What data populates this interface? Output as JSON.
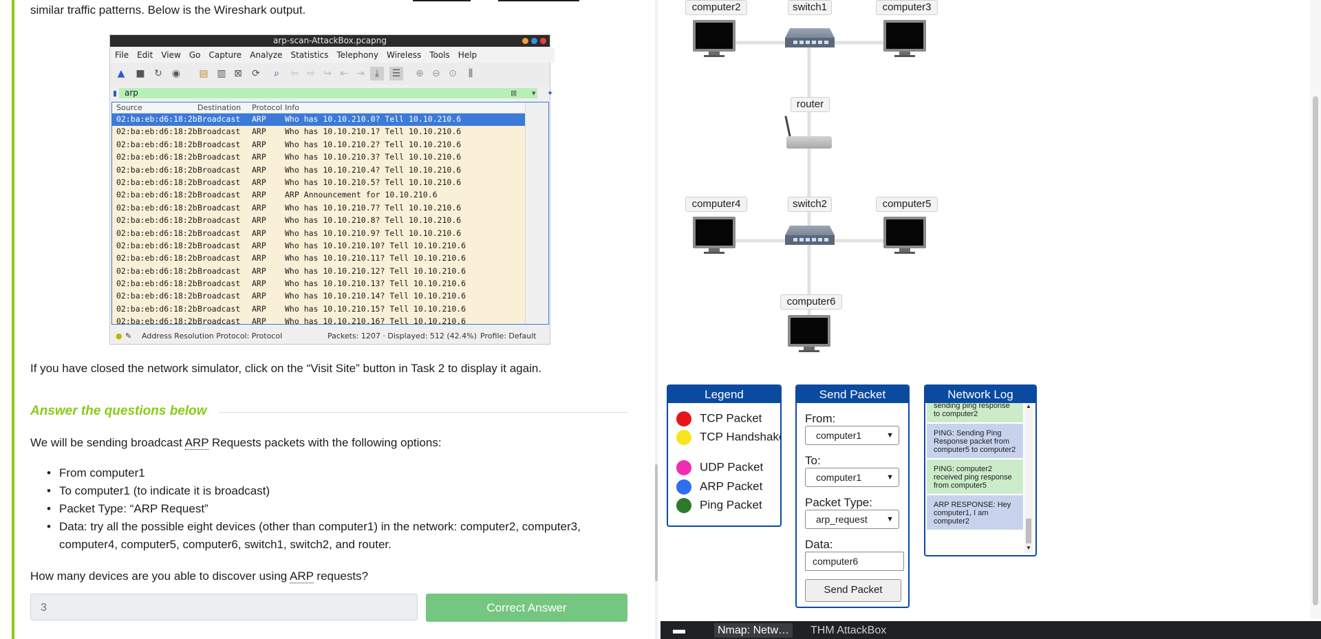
{
  "left": {
    "intro_text": "similar traffic patterns. Below is the Wireshark output.",
    "wireshark": {
      "title": "arp-scan-AttackBox.pcapng",
      "menu": [
        "File",
        "Edit",
        "View",
        "Go",
        "Capture",
        "Analyze",
        "Statistics",
        "Telephony",
        "Wireless",
        "Tools",
        "Help"
      ],
      "filter_value": "arp",
      "columns": [
        "Source",
        "Destination",
        "Protocol",
        "Info"
      ],
      "rows": [
        {
          "source": "02:ba:eb:d6:18:2b",
          "destination": "Broadcast",
          "protocol": "ARP",
          "info": "Who has 10.10.210.0? Tell 10.10.210.6"
        },
        {
          "source": "02:ba:eb:d6:18:2b",
          "destination": "Broadcast",
          "protocol": "ARP",
          "info": "Who has 10.10.210.1? Tell 10.10.210.6"
        },
        {
          "source": "02:ba:eb:d6:18:2b",
          "destination": "Broadcast",
          "protocol": "ARP",
          "info": "Who has 10.10.210.2? Tell 10.10.210.6"
        },
        {
          "source": "02:ba:eb:d6:18:2b",
          "destination": "Broadcast",
          "protocol": "ARP",
          "info": "Who has 10.10.210.3? Tell 10.10.210.6"
        },
        {
          "source": "02:ba:eb:d6:18:2b",
          "destination": "Broadcast",
          "protocol": "ARP",
          "info": "Who has 10.10.210.4? Tell 10.10.210.6"
        },
        {
          "source": "02:ba:eb:d6:18:2b",
          "destination": "Broadcast",
          "protocol": "ARP",
          "info": "Who has 10.10.210.5? Tell 10.10.210.6"
        },
        {
          "source": "02:ba:eb:d6:18:2b",
          "destination": "Broadcast",
          "protocol": "ARP",
          "info": "ARP Announcement for 10.10.210.6"
        },
        {
          "source": "02:ba:eb:d6:18:2b",
          "destination": "Broadcast",
          "protocol": "ARP",
          "info": "Who has 10.10.210.7? Tell 10.10.210.6"
        },
        {
          "source": "02:ba:eb:d6:18:2b",
          "destination": "Broadcast",
          "protocol": "ARP",
          "info": "Who has 10.10.210.8? Tell 10.10.210.6"
        },
        {
          "source": "02:ba:eb:d6:18:2b",
          "destination": "Broadcast",
          "protocol": "ARP",
          "info": "Who has 10.10.210.9? Tell 10.10.210.6"
        },
        {
          "source": "02:ba:eb:d6:18:2b",
          "destination": "Broadcast",
          "protocol": "ARP",
          "info": "Who has 10.10.210.10? Tell 10.10.210.6"
        },
        {
          "source": "02:ba:eb:d6:18:2b",
          "destination": "Broadcast",
          "protocol": "ARP",
          "info": "Who has 10.10.210.11? Tell 10.10.210.6"
        },
        {
          "source": "02:ba:eb:d6:18:2b",
          "destination": "Broadcast",
          "protocol": "ARP",
          "info": "Who has 10.10.210.12? Tell 10.10.210.6"
        },
        {
          "source": "02:ba:eb:d6:18:2b",
          "destination": "Broadcast",
          "protocol": "ARP",
          "info": "Who has 10.10.210.13? Tell 10.10.210.6"
        },
        {
          "source": "02:ba:eb:d6:18:2b",
          "destination": "Broadcast",
          "protocol": "ARP",
          "info": "Who has 10.10.210.14? Tell 10.10.210.6"
        },
        {
          "source": "02:ba:eb:d6:18:2b",
          "destination": "Broadcast",
          "protocol": "ARP",
          "info": "Who has 10.10.210.15? Tell 10.10.210.6"
        },
        {
          "source": "02:ba:eb:d6:18:2b",
          "destination": "Broadcast",
          "protocol": "ARP",
          "info": "Who has 10.10.210.16? Tell 10.10.210.6"
        }
      ],
      "status_protocol": "Address Resolution Protocol: Protocol",
      "status_packets": "Packets: 1207 · Displayed: 512 (42.4%)",
      "status_profile": "Profile: Default"
    },
    "closed_text": "If you have closed the network simulator, click on the “Visit Site” button in Task 2 to display it again.",
    "answer_heading": "Answer the questions below",
    "question_intro_a": "We will be sending broadcast ",
    "question_intro_abbr": "ARP",
    "question_intro_b": " Requests packets with the following options:",
    "bullets": [
      "From computer1",
      "To computer1 (to indicate it is broadcast)",
      "Packet Type: “ARP Request”",
      "Data: try all the possible eight devices (other than computer1) in the network: computer2, computer3, computer4, computer5, computer6, switch1, switch2, and router."
    ],
    "question_a": "How many devices are you able to discover using ",
    "question_abbr": "ARP",
    "question_b": " requests?",
    "answer_value": "3",
    "correct_label": "Correct Answer"
  },
  "topology": {
    "labels": {
      "computer2": "computer2",
      "switch1": "switch1",
      "computer3": "computer3",
      "router": "router",
      "computer4": "computer4",
      "switch2": "switch2",
      "computer5": "computer5",
      "computer6": "computer6"
    }
  },
  "legend": {
    "title": "Legend",
    "items": [
      {
        "label": "TCP Packet",
        "color": "#e8141c"
      },
      {
        "label": "TCP Handshake",
        "color": "#f7e51d"
      },
      {
        "label": "UDP Packet",
        "color": "#f02db4"
      },
      {
        "label": "ARP Packet",
        "color": "#2e6ef0"
      },
      {
        "label": "Ping Packet",
        "color": "#2d7a2d"
      }
    ]
  },
  "send_packet": {
    "title": "Send Packet",
    "from_label": "From:",
    "from_value": "computer1",
    "to_label": "To:",
    "to_value": "computer1",
    "type_label": "Packet Type:",
    "type_value": "arp_request",
    "data_label": "Data:",
    "data_value": "computer6",
    "button_label": "Send Packet"
  },
  "network_log": {
    "title": "Network Log",
    "entries": [
      {
        "text": "sending ping response to computer2",
        "style": "green"
      },
      {
        "text": "PING: Sending Ping Response packet from computer5 to computer2",
        "style": "blue"
      },
      {
        "text": "PING: computer2 received ping response from computer5",
        "style": "green"
      },
      {
        "text": "ARP RESPONSE: Hey computer1, I am computer2",
        "style": "blue"
      }
    ]
  },
  "taskbar": {
    "tabs": [
      "Nmap: Netw…",
      "THM AttackBox"
    ]
  },
  "colors": {
    "accent_green": "#88cc14",
    "panel_blue": "#0a4aa0",
    "correct_button": "#74c680",
    "selected_row": "#3b7ad8",
    "arp_row": "#faf0d7"
  }
}
